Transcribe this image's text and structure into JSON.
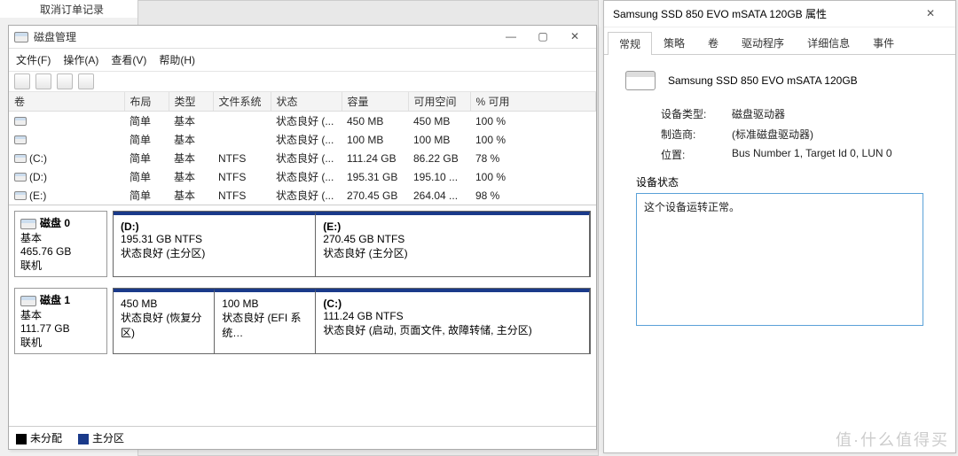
{
  "sidebar": {
    "cancel_orders": "取消订单记录"
  },
  "dm": {
    "title": "磁盘管理",
    "menu": {
      "file": "文件(F)",
      "action": "操作(A)",
      "view": "查看(V)",
      "help": "帮助(H)"
    },
    "columns": {
      "volume": "卷",
      "layout": "布局",
      "type": "类型",
      "fs": "文件系统",
      "status": "状态",
      "capacity": "容量",
      "free": "可用空间",
      "pct": "% 可用"
    },
    "rows": [
      {
        "vol": "",
        "layout": "简单",
        "type": "基本",
        "fs": "",
        "status": "状态良好 (...",
        "cap": "450 MB",
        "free": "450 MB",
        "pct": "100 %"
      },
      {
        "vol": "",
        "layout": "简单",
        "type": "基本",
        "fs": "",
        "status": "状态良好 (...",
        "cap": "100 MB",
        "free": "100 MB",
        "pct": "100 %"
      },
      {
        "vol": "(C:)",
        "layout": "简单",
        "type": "基本",
        "fs": "NTFS",
        "status": "状态良好 (...",
        "cap": "111.24 GB",
        "free": "86.22 GB",
        "pct": "78 %"
      },
      {
        "vol": "(D:)",
        "layout": "简单",
        "type": "基本",
        "fs": "NTFS",
        "status": "状态良好 (...",
        "cap": "195.31 GB",
        "free": "195.10 ...",
        "pct": "100 %"
      },
      {
        "vol": "(E:)",
        "layout": "简单",
        "type": "基本",
        "fs": "NTFS",
        "status": "状态良好 (...",
        "cap": "270.45 GB",
        "free": "264.04 ...",
        "pct": "98 %"
      }
    ],
    "disks": [
      {
        "name": "磁盘 0",
        "type": "基本",
        "size": "465.76 GB",
        "state": "联机",
        "partitions": [
          {
            "title": "(D:)",
            "line2": "195.31 GB NTFS",
            "line3": "状态良好 (主分区)",
            "flex": "42"
          },
          {
            "title": "(E:)",
            "line2": "270.45 GB NTFS",
            "line3": "状态良好 (主分区)",
            "flex": "58"
          }
        ]
      },
      {
        "name": "磁盘 1",
        "type": "基本",
        "size": "111.77 GB",
        "state": "联机",
        "partitions": [
          {
            "title": "",
            "line2": "450 MB",
            "line3": "状态良好 (恢复分区)",
            "flex": "20"
          },
          {
            "title": "",
            "line2": "100 MB",
            "line3": "状态良好 (EFI 系统…",
            "flex": "20"
          },
          {
            "title": "(C:)",
            "line2": "111.24 GB NTFS",
            "line3": "状态良好 (启动, 页面文件, 故障转储, 主分区)",
            "flex": "60"
          }
        ]
      }
    ],
    "legend": {
      "unalloc": "未分配",
      "primary": "主分区"
    }
  },
  "prop": {
    "title": "Samsung SSD 850 EVO mSATA 120GB 属性",
    "tabs": {
      "general": "常规",
      "policies": "策略",
      "volumes": "卷",
      "driver": "驱动程序",
      "details": "详细信息",
      "events": "事件"
    },
    "device_name": "Samsung SSD 850 EVO mSATA 120GB",
    "rows": {
      "type_k": "设备类型:",
      "type_v": "磁盘驱动器",
      "mfr_k": "制造商:",
      "mfr_v": "(标准磁盘驱动器)",
      "loc_k": "位置:",
      "loc_v": "Bus Number 1, Target Id 0, LUN 0"
    },
    "status_label": "设备状态",
    "status_text": "这个设备运转正常。"
  },
  "watermark": "值·什么值得买"
}
